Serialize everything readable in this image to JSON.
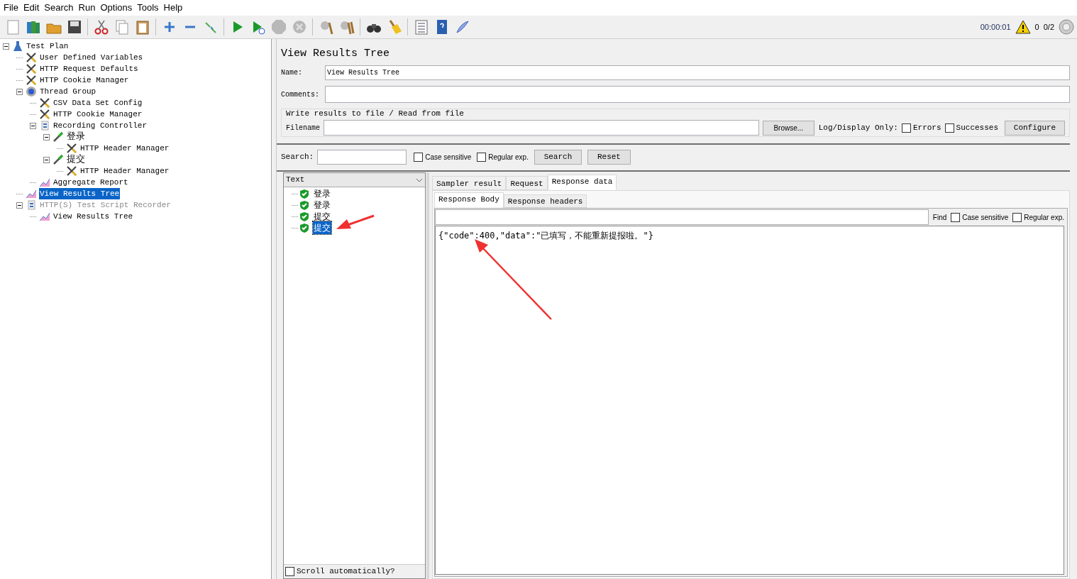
{
  "menu": [
    "File",
    "Edit",
    "Search",
    "Run",
    "Options",
    "Tools",
    "Help"
  ],
  "toolbar": [
    [
      {
        "kind": "new"
      },
      {
        "kind": "templates"
      },
      {
        "kind": "open"
      },
      {
        "kind": "save"
      }
    ],
    [
      {
        "kind": "cut"
      },
      {
        "kind": "copy"
      },
      {
        "kind": "paste"
      }
    ],
    [
      {
        "kind": "add"
      },
      {
        "kind": "remove"
      },
      {
        "kind": "toggle"
      }
    ],
    [
      {
        "kind": "start"
      },
      {
        "kind": "start-no-pause"
      },
      {
        "kind": "stop"
      },
      {
        "kind": "shutdown"
      }
    ],
    [
      {
        "kind": "clear"
      },
      {
        "kind": "clear-all"
      }
    ],
    [
      {
        "kind": "search"
      },
      {
        "kind": "reset-search"
      }
    ],
    [
      {
        "kind": "function-helper"
      },
      {
        "kind": "help"
      },
      {
        "kind": "logger"
      }
    ]
  ],
  "status": {
    "elapsed": "00:00:01",
    "warnings": "0",
    "threads": "0/2"
  },
  "tree": [
    {
      "label": "Test Plan",
      "kind": "plan",
      "expanded": true,
      "selected": false,
      "disabled": false,
      "children": [
        {
          "label": "User Defined Variables",
          "kind": "config",
          "selected": false,
          "disabled": false
        },
        {
          "label": "HTTP Request Defaults",
          "kind": "config",
          "selected": false,
          "disabled": false
        },
        {
          "label": "HTTP Cookie Manager",
          "kind": "config",
          "selected": false,
          "disabled": false
        },
        {
          "label": "Thread Group",
          "kind": "thread",
          "expanded": true,
          "selected": false,
          "disabled": false,
          "children": [
            {
              "label": "CSV Data Set Config",
              "kind": "config",
              "selected": false,
              "disabled": false
            },
            {
              "label": "HTTP Cookie Manager",
              "kind": "config",
              "selected": false,
              "disabled": false
            },
            {
              "label": "Recording Controller",
              "kind": "controller",
              "expanded": true,
              "selected": false,
              "disabled": false,
              "children": [
                {
                  "label": "登录",
                  "kind": "sampler",
                  "expanded": true,
                  "selected": false,
                  "disabled": false,
                  "children": [
                    {
                      "label": "HTTP Header Manager",
                      "kind": "config",
                      "selected": false,
                      "disabled": false
                    }
                  ]
                },
                {
                  "label": "提交",
                  "kind": "sampler",
                  "expanded": true,
                  "selected": false,
                  "disabled": false,
                  "children": [
                    {
                      "label": "HTTP Header Manager",
                      "kind": "config",
                      "selected": false,
                      "disabled": false
                    }
                  ]
                }
              ]
            },
            {
              "label": "Aggregate Report",
              "kind": "listener",
              "selected": false,
              "disabled": false
            }
          ]
        },
        {
          "label": "View Results Tree",
          "kind": "listener",
          "selected": true,
          "disabled": false
        },
        {
          "label": "HTTP(S) Test Script Recorder",
          "kind": "controller",
          "expanded": true,
          "selected": false,
          "disabled": true,
          "children": [
            {
              "label": "View Results Tree",
              "kind": "listener",
              "selected": false,
              "disabled": false
            }
          ]
        }
      ]
    }
  ],
  "panel": {
    "title": "View Results Tree",
    "name_label": "Name:",
    "name_value": "View Results Tree",
    "comments_label": "Comments:",
    "file_group": "Write results to file / Read from file",
    "filename_label": "Filename",
    "browse_button": "Browse...",
    "log_label": "Log/Display Only:",
    "log_options": [
      {
        "label": "Errors",
        "checked": false
      },
      {
        "label": "Successes",
        "checked": false
      }
    ],
    "configure_button": "Configure"
  },
  "search": {
    "label": "Search:",
    "options": [
      {
        "label": "Case sensitive",
        "checked": false
      },
      {
        "label": "Regular exp.",
        "checked": false
      }
    ],
    "search_button": "Search",
    "reset_button": "Reset"
  },
  "results": {
    "renderer": "Text",
    "items": [
      {
        "label": "登录",
        "kind": "ok",
        "selected": false
      },
      {
        "label": "登录",
        "kind": "ok",
        "selected": false
      },
      {
        "label": "提交",
        "kind": "ok",
        "selected": false
      },
      {
        "label": "提交",
        "kind": "ok",
        "selected": true
      }
    ],
    "scroll_label": "Scroll automatically?",
    "scroll_checked": false
  },
  "tabs": [
    {
      "label": "Sampler result",
      "selected": false
    },
    {
      "label": "Request",
      "selected": false
    },
    {
      "label": "Response data",
      "selected": true
    }
  ],
  "subtabs": [
    {
      "label": "Response Body",
      "selected": true
    },
    {
      "label": "Response headers",
      "selected": false
    }
  ],
  "find": {
    "label": "Find",
    "options": [
      {
        "label": "Case sensitive",
        "checked": false
      },
      {
        "label": "Regular exp.",
        "checked": false
      }
    ]
  },
  "body": "{\"code\":400,\"data\":\"已填写，不能重新提报啦。\"}"
}
